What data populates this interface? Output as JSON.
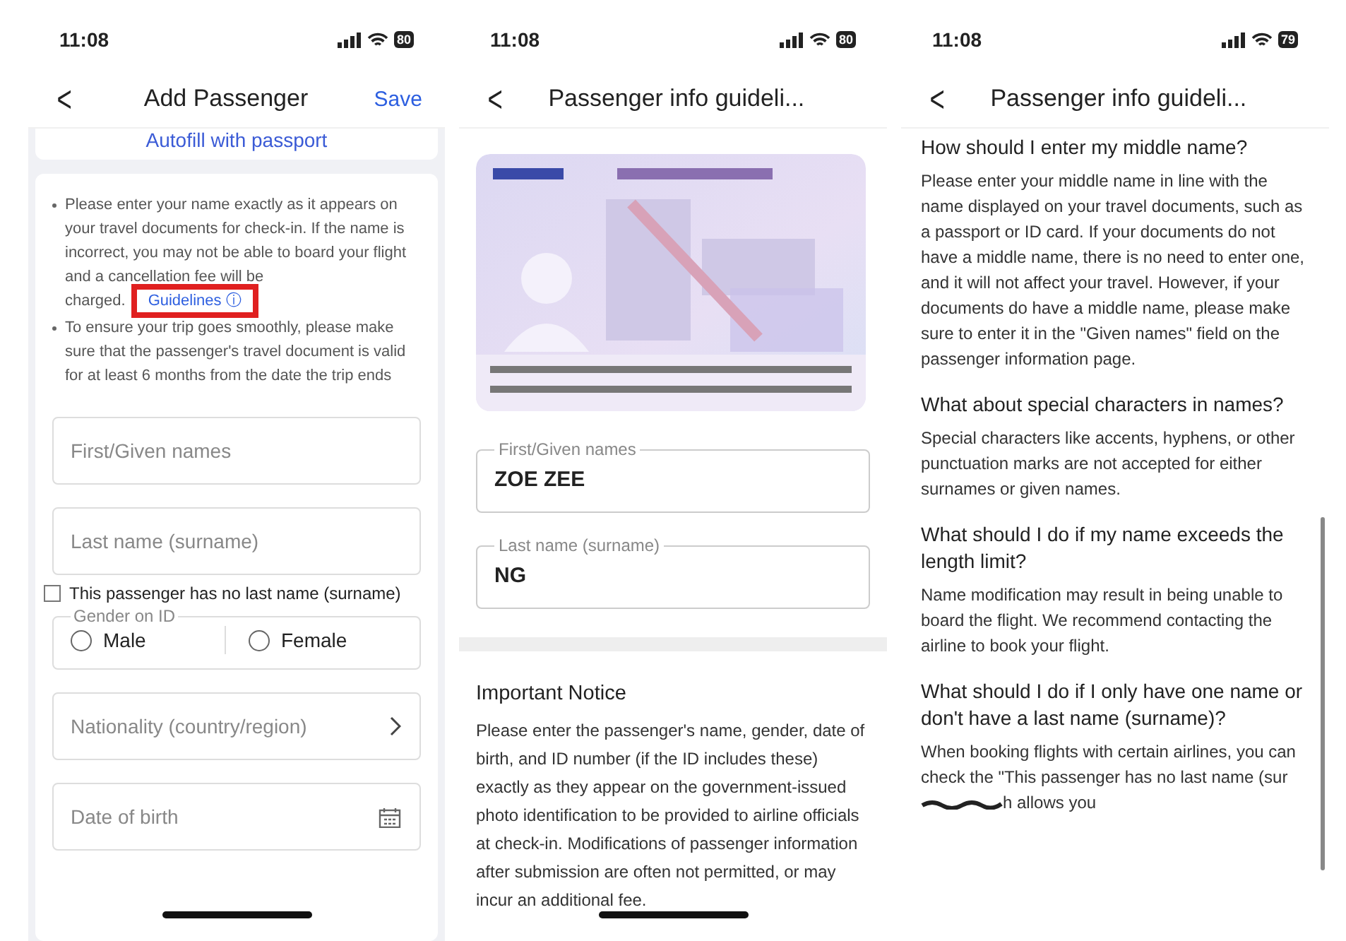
{
  "add_passenger": {
    "status_bar": {
      "time": "11:08",
      "battery": "80"
    },
    "header": {
      "back": "<",
      "title": "Add Passenger",
      "save": "Save"
    },
    "autofill": "Autofill with passport",
    "notes": [
      "Please enter your name exactly as it appears on your travel documents for check-in. If the name is incorrect, you may not be able to board your flight and a cancellation fee will be charged.",
      "To ensure your trip goes smoothly, please make sure that the passenger's travel document is valid for at least 6 months from the date the trip ends"
    ],
    "guidelines_link": "Guidelines ⓘ",
    "first_name": {
      "placeholder": "First/Given names"
    },
    "last_name": {
      "placeholder": "Last name (surname)"
    },
    "no_last_name": {
      "label": "This passenger has no last name (surname)",
      "checked": false
    },
    "gender": {
      "legend": "Gender on ID",
      "options": [
        {
          "label": "Male",
          "selected": false
        },
        {
          "label": "Female",
          "selected": false
        }
      ]
    },
    "nationality": {
      "placeholder": "Nationality (country/region)"
    },
    "date_of_birth": {
      "placeholder": "Date of birth"
    }
  },
  "guidelines_passport": {
    "status_bar": {
      "time": "11:08",
      "battery": "80"
    },
    "header": {
      "back": "<",
      "title": "Passenger info guideli..."
    },
    "fields": [
      {
        "label": "First/Given names",
        "value": "ZOE ZEE"
      },
      {
        "label": "Last name (surname)",
        "value": "NG"
      }
    ],
    "notice": {
      "heading": "Important Notice",
      "body": "Please enter the passenger's name, gender, date of birth, and ID number (if the ID includes these) exactly as they appear on the government-issued photo identification to be provided to airline officials at check-in. Modifications of passenger information after submission are often not permitted, or may incur an additional fee."
    }
  },
  "guidelines_faq": {
    "status_bar": {
      "time": "11:08",
      "battery": "79"
    },
    "header": {
      "back": "<",
      "title": "Passenger info guideli..."
    },
    "faq": [
      {
        "question": "How should I enter my middle name?",
        "answer": "Please enter your middle name in line with the name displayed on your travel documents, such as a passport or ID card. If your documents do not have a middle name, there is no need to enter one, and it will not affect your travel. However, if your documents do have a middle name, please make sure to enter it in the \"Given names\" field on the passenger information page."
      },
      {
        "question": "What about special characters in names?",
        "answer": "Special characters like accents, hyphens, or other punctuation marks are not accepted for either surnames or given names."
      },
      {
        "question": "What should I do if my name exceeds the length limit?",
        "answer": "Name modification may result in being unable to board the flight. We recommend contacting the airline to book your flight."
      },
      {
        "question": "What should I do if I only have one name or don't have a last name (surname)?",
        "answer": "When booking flights with certain airlines, you can check the \"This passenger has no last name (sur",
        "answer_after_scribble": "h allows you"
      }
    ]
  }
}
